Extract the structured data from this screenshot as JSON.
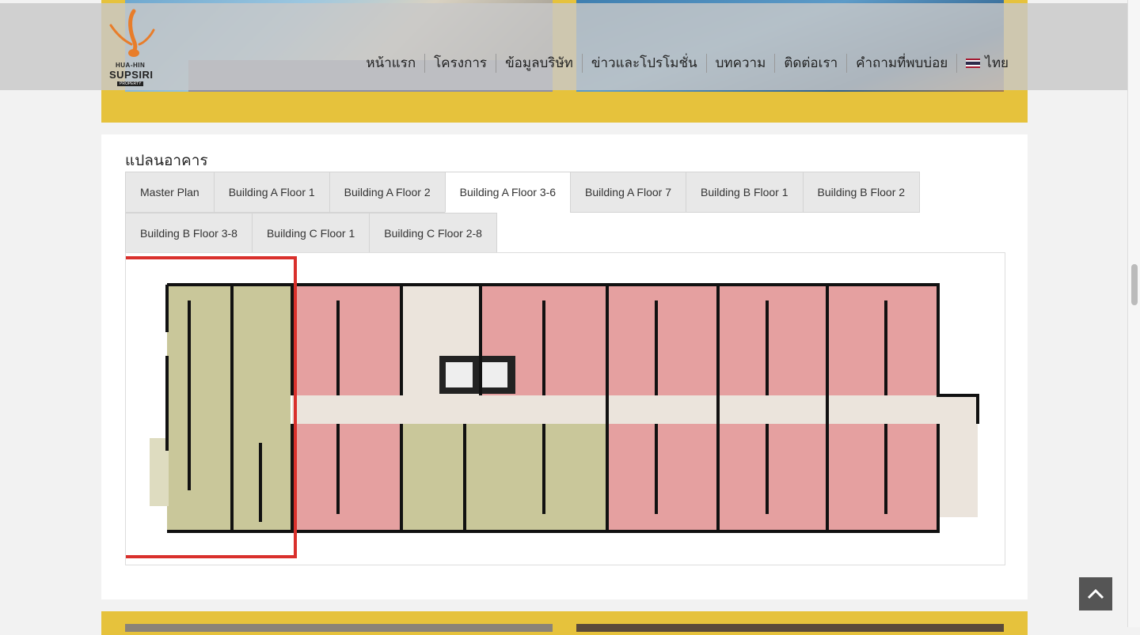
{
  "brand": {
    "line1": "HUA-HIN",
    "line2": "SUPSIRI",
    "line3": "PROPERTY"
  },
  "nav": {
    "items": [
      "หน้าแรก",
      "โครงการ",
      "ข้อมูลบริษัท",
      "ข่าวและโปรโมชั่น",
      "บทความ",
      "ติดต่อเรา",
      "คำถามที่พบบ่อย"
    ],
    "language": "ไทย"
  },
  "section": {
    "title": "แปลนอาคาร"
  },
  "tabs": {
    "row1": [
      "Master Plan",
      "Building A Floor 1",
      "Building A Floor 2",
      "Building A Floor 3-6",
      "Building A Floor 7",
      "Building B Floor 1",
      "Building B Floor 2"
    ],
    "row2": [
      "Building B Floor 3-8",
      "Building C Floor 1",
      "Building C Floor 2-8"
    ],
    "active": "Building A Floor 3-6"
  },
  "colors": {
    "accent_yellow": "#e6c23c",
    "unit_pink": "#e5a0a0",
    "unit_olive": "#c9c79a",
    "corridor": "#ebe4dc",
    "highlight_red": "#d9302c"
  },
  "icons": {
    "back_to_top": "chevron-up-icon",
    "language_flag": "thai-flag-icon"
  }
}
